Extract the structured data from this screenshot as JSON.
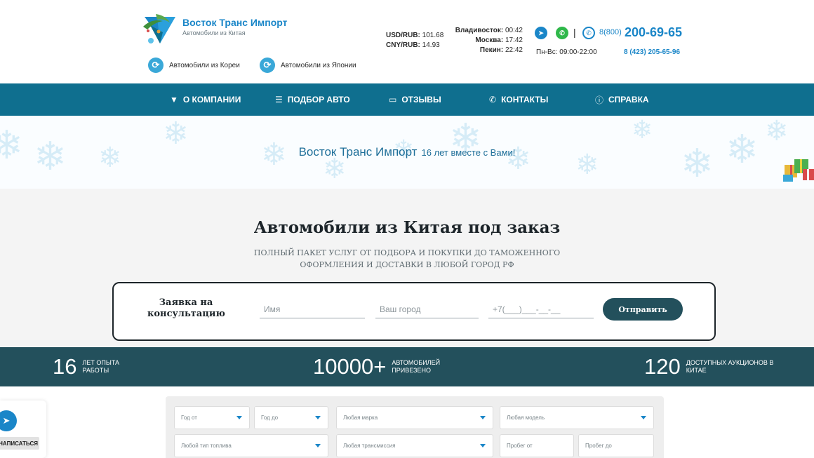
{
  "brand": {
    "name": "Восток Транс Импорт",
    "tagline": "Автомобили из Китая"
  },
  "country_links": [
    {
      "label": "Автомобили из Кореи"
    },
    {
      "label": "Автомобили из Японии"
    }
  ],
  "rates": {
    "usd_label": "USD/RUB:",
    "usd_value": "101.68",
    "cny_label": "CNY/RUB:",
    "cny_value": "14.93"
  },
  "clocks": [
    {
      "city": "Владивосток:",
      "time": "00:42"
    },
    {
      "city": "Москва:",
      "time": "17:42"
    },
    {
      "city": "Пекин:",
      "time": "22:42"
    }
  ],
  "contacts": {
    "divider": "|",
    "phone_prefix": "8(800)",
    "phone_main": "200-69-65",
    "hours": "Пн-Вс: 09:00-22:00",
    "phone_local": "8 (423) 205-65-96"
  },
  "nav": [
    {
      "label": "О КОМПАНИИ",
      "icon": "logo-v-icon"
    },
    {
      "label": "ПОДБОР АВТО",
      "icon": "document-icon"
    },
    {
      "label": "ОТЗЫВЫ",
      "icon": "chat-icon"
    },
    {
      "label": "КОНТАКТЫ",
      "icon": "phone-icon"
    },
    {
      "label": "СПРАВКА",
      "icon": "info-icon"
    }
  ],
  "banner": {
    "brand": "Восток Транс Импорт",
    "slogan": "16 лет вместе с Вами!"
  },
  "hero": {
    "title": "Автомобили из Китая под заказ",
    "subtitle": "Полный пакет услуг от подбора и покупки до таможенного оформления и доставки в любой город РФ"
  },
  "form": {
    "label": "Заявка на консультацию",
    "name_placeholder": "Имя",
    "city_placeholder": "Ваш город",
    "phone_placeholder": "+7(___)___-__-__",
    "submit_label": "Отправить"
  },
  "stats": [
    {
      "number": "16",
      "label": "лет опыта работы"
    },
    {
      "number": "10000+",
      "label": "автомобилей привезено"
    },
    {
      "number": "120",
      "label": "доступных аукционов в Китае"
    }
  ],
  "filters": {
    "year_from": "Год от",
    "year_to": "Год до",
    "make": "Любая марка",
    "model": "Любая модель",
    "fuel": "Любой тип топлива",
    "transmission": "Любая трансмиссия",
    "mileage_from": "Пробег от",
    "mileage_to": "Пробег до"
  },
  "side_widget": {
    "button_label": "НАПИСАТЬСЯ"
  },
  "colors": {
    "nav_bg": "#0f6f8f",
    "accent": "#1a86c8",
    "stats_bg": "#23505c",
    "whatsapp": "#2fb84a"
  }
}
